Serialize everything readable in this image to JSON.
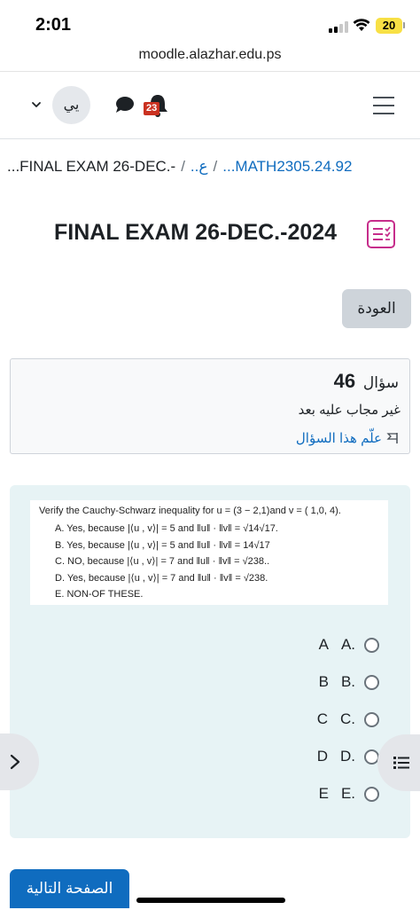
{
  "status_bar": {
    "time": "2:01",
    "battery": "20"
  },
  "browser": {
    "url": "moodle.alazhar.edu.ps"
  },
  "navbar": {
    "avatar_initials": "يي",
    "notification_count": "23"
  },
  "breadcrumb": {
    "items": [
      "...FINAL EXAM 26-DEC.-",
      "..ع",
      "...MATH2305.24.92"
    ],
    "separator": "/"
  },
  "page": {
    "title": "FINAL EXAM 26-DEC.-2024",
    "back_label": "العودة"
  },
  "question_info": {
    "heading_label": "سؤال",
    "number": "46",
    "state": "غير مجاب عليه بعد",
    "flag_label": "علّم هذا السؤال"
  },
  "question_image": {
    "prompt": "Verify the Cauchy-Schwarz inequality for u = (3 − 2,1)and  v =  ( 1,0, 4).",
    "options": [
      "A.  Yes, because |⟨u , v⟩| = 5  and ‖u‖ · ‖v‖ = √14√17.",
      "B.  Yes, because |⟨u , v⟩| = 5  and ‖u‖ · ‖v‖ = 14√17",
      "C.  NO, because |⟨u , v⟩| = 7  and ‖u‖ · ‖v‖ = √238..",
      "D.  Yes, because |⟨u , v⟩| = 7  and ‖u‖ · ‖v‖ = √238.",
      "E.  NON-OF THESE."
    ]
  },
  "answers": [
    {
      "letter": "A",
      "label": "A."
    },
    {
      "letter": "B",
      "label": "B."
    },
    {
      "letter": "C",
      "label": "C."
    },
    {
      "letter": "D",
      "label": "D."
    },
    {
      "letter": "E",
      "label": "E."
    }
  ],
  "footer": {
    "next_label": "الصفحة التالية"
  },
  "colors": {
    "link": "#0f6cbf",
    "badge": "#ca3120",
    "quiz_icon": "#c62d8b",
    "question_bg": "#e7f3f5"
  }
}
